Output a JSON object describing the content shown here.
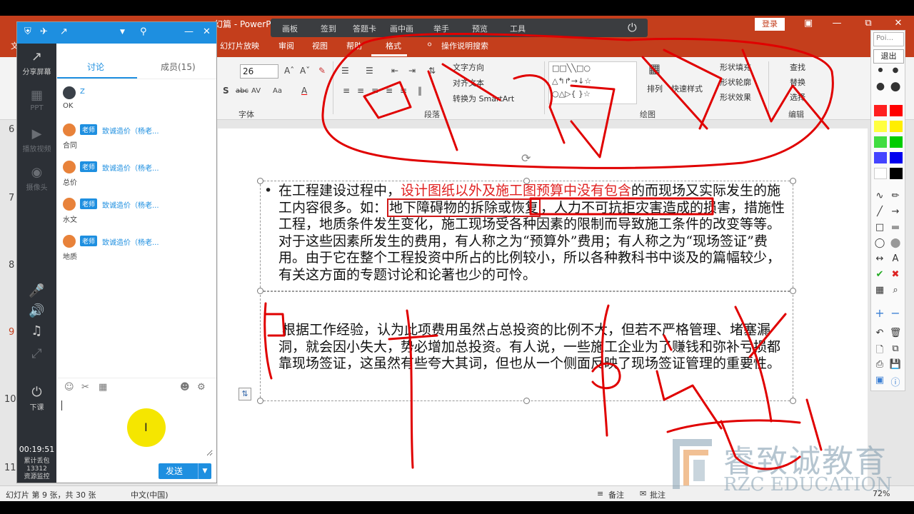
{
  "ppt": {
    "title": "幻篇 - PowerPoi",
    "login": "登录",
    "tabs": [
      "文",
      "幻灯片放映",
      "审阅",
      "视图",
      "帮助",
      "格式",
      "操作说明搜索"
    ],
    "ribbon": {
      "font_size": "26",
      "text_direction": "文字方向",
      "align_text": "对齐文本",
      "to_smartart": "转换为 SmartArt",
      "arrange": "排列",
      "quick_styles": "快速样式",
      "shape_fill": "形状填充",
      "shape_outline": "形状轮廓",
      "shape_effects": "形状效果",
      "find": "查找",
      "replace": "替换",
      "select": "选择",
      "group_font": "字体",
      "group_paragraph": "段落",
      "group_drawing": "绘图",
      "group_editing": "编辑"
    },
    "slide_numbers": [
      "6",
      "7",
      "8",
      "9",
      "10",
      "11"
    ],
    "status": {
      "slide_info": "幻灯片 第 9 张，共 30 张",
      "language": "中文(中国)",
      "notes": "备注",
      "comments": "批注",
      "zoom": "72%"
    }
  },
  "class_toolbar": {
    "items": [
      "画板",
      "签到",
      "答题卡",
      "画中画",
      "举手",
      "预览",
      "工具"
    ]
  },
  "slide": {
    "p1_a": "在工程建设过程中，",
    "p1_red": "设计图纸以外及施工图预算中没有包含",
    "p1_b": "的而现场又实际发生的施工内容很多。如：",
    "p1_boxed": "地下障碍物的拆除或恢复",
    "p1_c": "，人力不可抗拒灾害造成的损害，措施性工程，地质条件发生变化，施工现场受各种因素的限制而导致施工条件的改变等等。对于这些因素所发生的费用，有人称之为“预算外”费用；有人称之为“现场签证”费用。由于它在整个工程投资中所占的比例较小，所以各种教科书中谈及的篇幅较少，有关这方面的专题讨论和论著也少的可怜。",
    "p2": "根据工作经验，认为此项费用虽然占总投资的比例不大，但若不严格管理、堵塞漏洞，就会因小失大，势必增加总投资。有人说，一些施工企业为了赚钱和弥补亏损都靠现场签证，这虽然有些夸大其词，但也从一个侧面反映了现场签证管理的重要性。"
  },
  "draw_toolbar": {
    "field": "Poi...",
    "exit": "退出",
    "colors": [
      "#ff2020",
      "#ff0000",
      "#ffff40",
      "#ffee00",
      "#40dd40",
      "#00cc00",
      "#4444ff",
      "#0000ee",
      "#ffffff",
      "#000000"
    ]
  },
  "chat": {
    "side": {
      "share": "分享屏幕",
      "ppt": "PPT",
      "video": "播放视频",
      "camera": "摄像头",
      "end": "下课",
      "timer": "00:19:51",
      "packets_label": "累计丢包",
      "packets": "13312",
      "monitor": "资源监控"
    },
    "tabs": {
      "discussion": "讨论",
      "members": "成员(15)"
    },
    "messages": [
      {
        "name": "Z",
        "badge": "",
        "text": "OK"
      },
      {
        "name": "致诚造价（杨老...",
        "badge": "老师",
        "text": "合同"
      },
      {
        "name": "致诚造价（杨老...",
        "badge": "老师",
        "text": "总价"
      },
      {
        "name": "致诚造价（杨老...",
        "badge": "老师",
        "text": "水文"
      },
      {
        "name": "致诚造价（杨老...",
        "badge": "老师",
        "text": "地质"
      }
    ],
    "send": "发送"
  },
  "watermark": {
    "cn": "睿致诚教育",
    "en": "RZC EDUCATION"
  },
  "icons": [
    "share-screen-icon",
    "ppt-icon",
    "video-icon",
    "camera-icon",
    "mic-icon",
    "speaker-icon",
    "music-icon",
    "fullscreen-icon",
    "power-icon",
    "emoji-icon",
    "scissors-icon",
    "image-icon",
    "settings-icon"
  ]
}
